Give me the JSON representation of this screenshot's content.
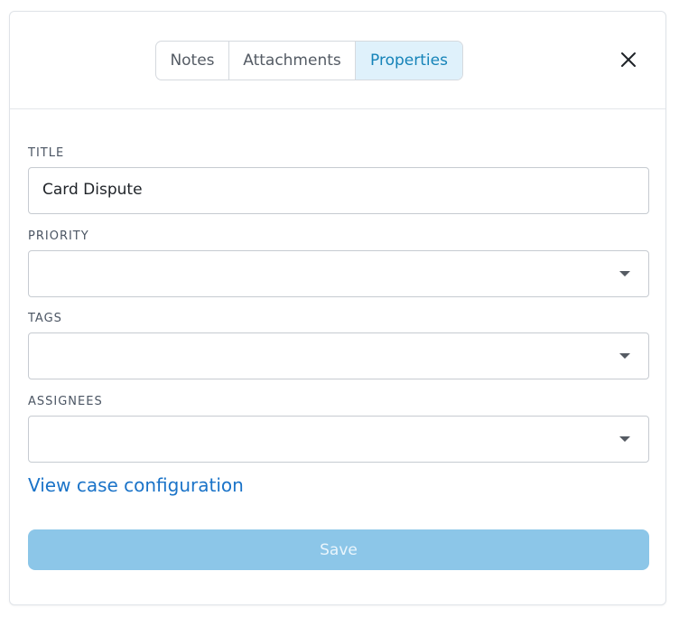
{
  "tabs": {
    "notes": "Notes",
    "attachments": "Attachments",
    "properties": "Properties",
    "active": "Properties"
  },
  "close_icon": "close-icon",
  "form": {
    "title_label": "TITLE",
    "title_value": "Card Dispute",
    "priority_label": "PRIORITY",
    "priority_value": "",
    "tags_label": "TAGS",
    "tags_value": "",
    "assignees_label": "ASSIGNEES",
    "assignees_value": ""
  },
  "link_text": "View case configuration",
  "save_label": "Save",
  "colors": {
    "accent": "#1583b8",
    "active_tab_bg": "#dff1fb",
    "link": "#1a73c8",
    "save_bg_disabled": "#8cc6e8"
  }
}
